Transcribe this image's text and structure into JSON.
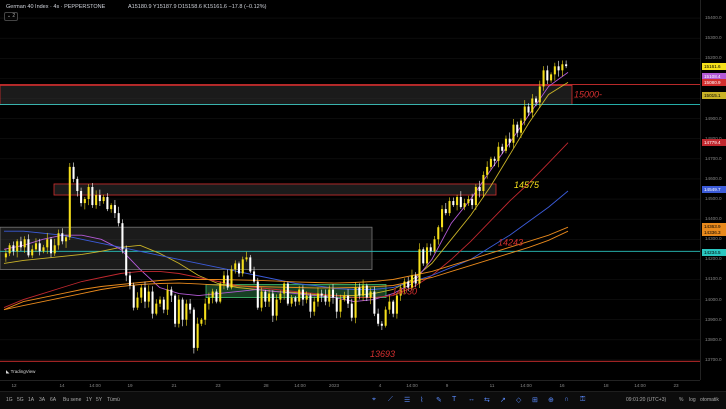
{
  "header": {
    "title": "German 40 Index · 4s · PEPPERSTONE",
    "ohlc": "A15180.9 Y15187.9 D15158.6 K15161.6 −17.8 (−0.12%)",
    "collapse_label": "2"
  },
  "colors": {
    "up": "#f6e01b",
    "down": "#ffffff",
    "ma_yellow": "#c9b227",
    "ma_purple": "#b35ad6",
    "ma_red": "#c0282f",
    "ma_blue": "#3b5bd9",
    "ma_orange": "#e8891c",
    "level_red": "#d32f2f",
    "level_teal": "#2ac6c0",
    "level_green": "#3fbf6f"
  },
  "chart_data": {
    "type": "candlestick",
    "title": "German 40 Index · 4s · PEPPERSTONE",
    "y_ticks": [
      15400,
      15300,
      15200,
      15100,
      15000,
      14900,
      14800,
      14700,
      14600,
      14500,
      14400,
      14300,
      14200,
      14100,
      14000,
      13900,
      13800,
      13700
    ],
    "x_ticks": [
      "12",
      "14",
      "14:00",
      "19",
      "21",
      "23",
      "28",
      "14:00",
      "2023",
      "4",
      "14:00",
      "9",
      "11",
      "14:00",
      "16",
      "18",
      "14:00",
      "23"
    ],
    "ylim": [
      13640,
      15450
    ],
    "close_path": [
      14230,
      14270,
      14240,
      14290,
      14260,
      14300,
      14220,
      14250,
      14280,
      14240,
      14260,
      14300,
      14230,
      14270,
      14330,
      14290,
      14310,
      14660,
      14600,
      14540,
      14480,
      14500,
      14560,
      14470,
      14520,
      14490,
      14510,
      14450,
      14470,
      14430,
      14380,
      14250,
      14120,
      14070,
      13960,
      14010,
      14060,
      13990,
      14040,
      13930,
      13980,
      14000,
      13950,
      14050,
      14020,
      13880,
      14000,
      13900,
      13980,
      13950,
      13760,
      13880,
      13900,
      13980,
      14010,
      14040,
      13990,
      14080,
      14120,
      14060,
      14150,
      14180,
      14130,
      14200,
      14210,
      14140,
      14090,
      13960,
      14040,
      13990,
      14030,
      13920,
      14000,
      14030,
      14080,
      13980,
      14010,
      13990,
      14050,
      14000,
      14020,
      13940,
      13990,
      14030,
      14020,
      13990,
      14050,
      14010,
      13940,
      14000,
      14020,
      13980,
      13910,
      14060,
      14020,
      14070,
      14010,
      14040,
      13930,
      13880,
      13870,
      13950,
      13990,
      13930,
      14020,
      14060,
      14090,
      14060,
      14120,
      14080,
      14250,
      14180,
      14260,
      14240,
      14300,
      14360,
      14450,
      14430,
      14490,
      14470,
      14510,
      14460,
      14480,
      14500,
      14470,
      14560,
      14540,
      14620,
      14660,
      14700,
      14690,
      14760,
      14740,
      14800,
      14780,
      14870,
      14830,
      14890,
      14960,
      14930,
      15000,
      14980,
      15060,
      15140,
      15090,
      15120,
      15160,
      15140,
      15170,
      15161
    ],
    "series": [
      {
        "name": "",
        "values": [
          14180,
          14195,
          14205,
          14215,
          14225,
          14240,
          14260,
          14270,
          14230,
          14180,
          14120,
          14080,
          14060,
          14050,
          14040,
          14035,
          14025,
          14020,
          14020,
          14030,
          14050,
          14100,
          14180,
          14300,
          14420,
          14560,
          14720,
          14880,
          15020,
          15080
        ]
      },
      {
        "name": "",
        "values": [
          14250,
          14270,
          14300,
          14320,
          14320,
          14300,
          14250,
          14150,
          14060,
          14030,
          14020,
          14030,
          14040,
          14050,
          14040,
          14030,
          14020,
          14010,
          13990,
          14000,
          14030,
          14080,
          14200,
          14380,
          14500,
          14640,
          14780,
          14920,
          15060,
          15130
        ]
      },
      {
        "name": "",
        "values": [
          13960,
          14000,
          14030,
          14060,
          14090,
          14110,
          14130,
          14140,
          14140,
          14130,
          14110,
          14090,
          14070,
          14060,
          14050,
          14040,
          14030,
          14020,
          14010,
          14010,
          14020,
          14060,
          14120,
          14200,
          14290,
          14390,
          14490,
          14580,
          14680,
          14780
        ]
      },
      {
        "name": "",
        "values": [
          14340,
          14340,
          14330,
          14320,
          14300,
          14280,
          14260,
          14240,
          14220,
          14200,
          14180,
          14160,
          14140,
          14120,
          14100,
          14080,
          14070,
          14055,
          14050,
          14050,
          14060,
          14090,
          14120,
          14160,
          14200,
          14260,
          14320,
          14390,
          14460,
          14540
        ]
      },
      {
        "name": "",
        "values": [
          13950,
          13990,
          14010,
          14030,
          14050,
          14065,
          14075,
          14085,
          14095,
          14100,
          14100,
          14100,
          14098,
          14096,
          14092,
          14088,
          14085,
          14082,
          14085,
          14090,
          14100,
          14120,
          14140,
          14170,
          14200,
          14230,
          14260,
          14290,
          14320,
          14360
        ]
      },
      {
        "name": "",
        "values": [
          13950,
          13970,
          13990,
          14010,
          14030,
          14050,
          14065,
          14075,
          14080,
          14082,
          14078,
          14072,
          14068,
          14065,
          14062,
          14060,
          14058,
          14058,
          14060,
          14064,
          14070,
          14090,
          14110,
          14140,
          14170,
          14200,
          14230,
          14260,
          14295,
          14340
        ]
      }
    ],
    "levels": [
      {
        "price": 15070,
        "color": "level_red"
      },
      {
        "price": 14970,
        "color": "level_teal"
      },
      {
        "price": 14240,
        "color": "level_teal"
      },
      {
        "price": 13693,
        "color": "level_red"
      }
    ],
    "zones": [
      {
        "top": 15065,
        "bottom": 14970,
        "color": "#d32f2f",
        "fill": "rgba(60,60,60,0.45)"
      },
      {
        "top": 14575,
        "bottom": 14520,
        "color": "#d32f2f",
        "fill": "rgba(60,60,60,0.45)"
      },
      {
        "top": 14360,
        "bottom": 14150,
        "color": "#777777",
        "fill": "rgba(60,60,60,0.45)"
      },
      {
        "top": 14075,
        "bottom": 14010,
        "color": "#3fbf6f",
        "fill": "rgba(60,160,90,0.4)"
      }
    ],
    "annotations": [
      {
        "text": "15000-",
        "price": 15020,
        "color": "#d32f2f"
      },
      {
        "text": "14575",
        "price": 14570,
        "color": "#f6e01b"
      },
      {
        "text": "14243",
        "price": 14285,
        "color": "#d32f2f"
      },
      {
        "text": "14030",
        "price": 14040,
        "color": "#d32f2f"
      },
      {
        "text": "13693",
        "price": 13730,
        "color": "#d32f2f"
      }
    ],
    "price_labels": [
      {
        "text": "15161.6",
        "price": 15161,
        "bg": "#f6e01b",
        "fg": "#000000"
      },
      {
        "text": "15108.4",
        "price": 15108,
        "bg": "#b35ad6",
        "fg": "#ffffff"
      },
      {
        "text": "15080.9",
        "price": 15081,
        "bg": "#d32f2f",
        "fg": "#ffffff"
      },
      {
        "text": "15015.1",
        "price": 15015,
        "bg": "#c9b227",
        "fg": "#000000"
      },
      {
        "text": "14779.4",
        "price": 14779,
        "bg": "#c0282f",
        "fg": "#ffffff"
      },
      {
        "text": "14549.7",
        "price": 14549,
        "bg": "#3b5bd9",
        "fg": "#ffffff"
      },
      {
        "text": "14363.9",
        "price": 14364,
        "bg": "#e8891c",
        "fg": "#000000"
      },
      {
        "text": "14336.3",
        "price": 14336,
        "bg": "#e8891c",
        "fg": "#000000"
      },
      {
        "text": "14234.5",
        "price": 14234,
        "bg": "#2ac6c0",
        "fg": "#000000"
      }
    ]
  },
  "bottom_bar": {
    "periods": [
      "1G",
      "5G",
      "1A",
      "3A",
      "6A",
      "Bu sene",
      "1Y",
      "5Y",
      "Tümü"
    ],
    "clock": "09:01:20 (UTC+3)",
    "right_buttons": [
      "%",
      "log",
      "otomatik"
    ]
  },
  "branding": "TradingView"
}
